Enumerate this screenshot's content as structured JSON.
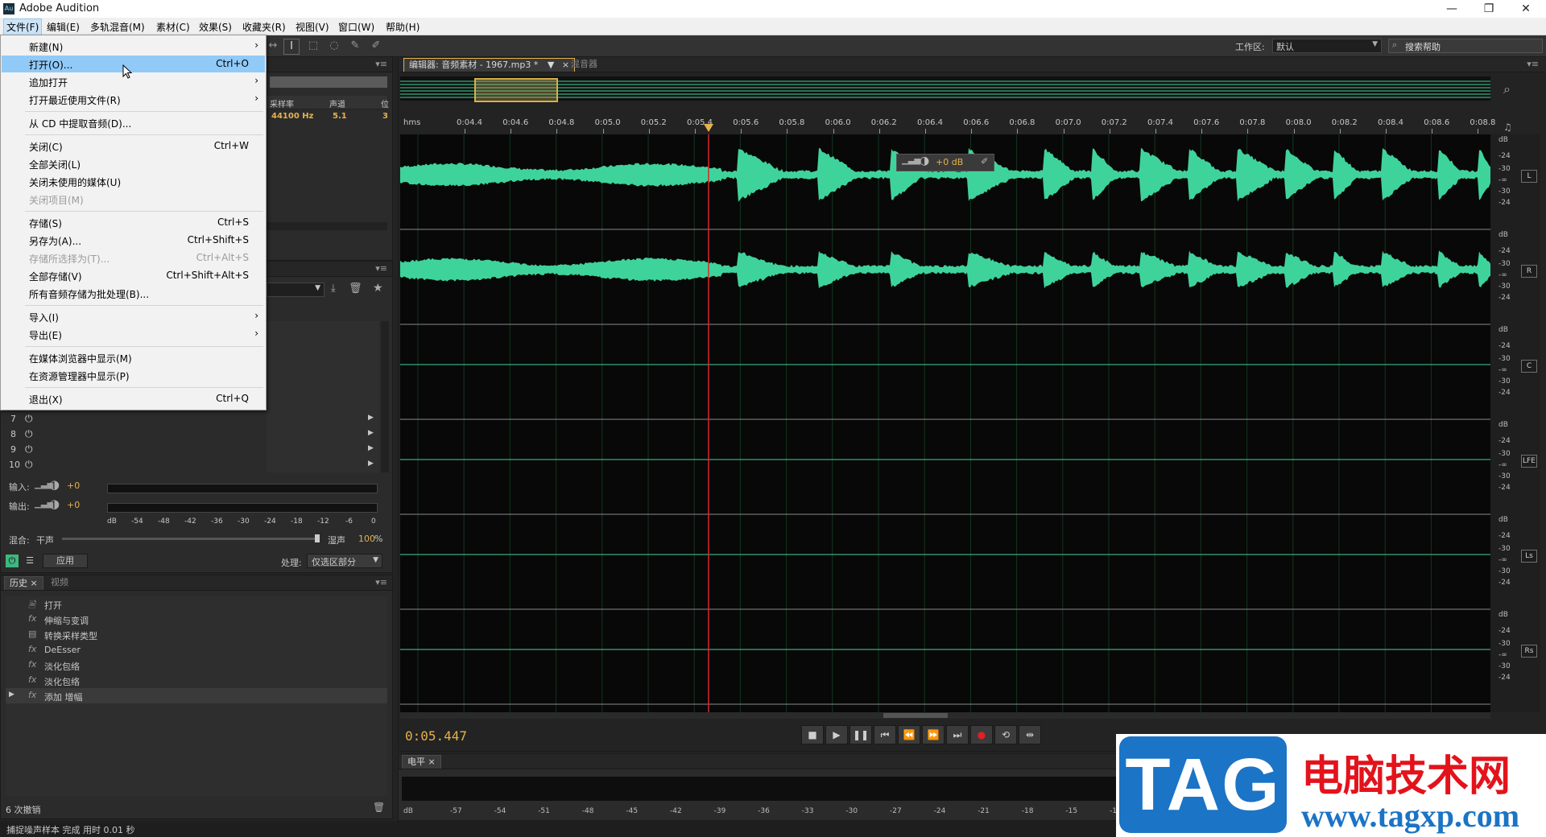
{
  "window": {
    "title": "Adobe Audition",
    "app_icon": "Au"
  },
  "menubar": [
    "文件(F)",
    "编辑(E)",
    "多轨混音(M)",
    "素材(C)",
    "效果(S)",
    "收藏夹(R)",
    "视图(V)",
    "窗口(W)",
    "帮助(H)"
  ],
  "workspace": {
    "label": "工作区:",
    "value": "默认"
  },
  "search": {
    "placeholder": "搜索帮助"
  },
  "file_menu": {
    "items": [
      {
        "label": "新建(N)",
        "shortcut": "",
        "submenu": true,
        "disabled": false
      },
      {
        "label": "打开(O)...",
        "shortcut": "Ctrl+O",
        "submenu": false,
        "disabled": false,
        "highlighted": true
      },
      {
        "label": "追加打开",
        "shortcut": "",
        "submenu": true,
        "disabled": false
      },
      {
        "label": "打开最近使用文件(R)",
        "shortcut": "",
        "submenu": true,
        "disabled": false
      },
      {
        "label": "从 CD 中提取音频(D)...",
        "shortcut": "",
        "submenu": false,
        "disabled": false
      },
      {
        "label": "关闭(C)",
        "shortcut": "Ctrl+W",
        "submenu": false,
        "disabled": false
      },
      {
        "label": "全部关闭(L)",
        "shortcut": "",
        "submenu": false,
        "disabled": false
      },
      {
        "label": "关闭未使用的媒体(U)",
        "shortcut": "",
        "submenu": false,
        "disabled": false
      },
      {
        "label": "关闭项目(M)",
        "shortcut": "",
        "submenu": false,
        "disabled": true
      },
      {
        "label": "存储(S)",
        "shortcut": "Ctrl+S",
        "submenu": false,
        "disabled": false
      },
      {
        "label": "另存为(A)...",
        "shortcut": "Ctrl+Shift+S",
        "submenu": false,
        "disabled": false
      },
      {
        "label": "存储所选择为(T)...",
        "shortcut": "Ctrl+Alt+S",
        "submenu": false,
        "disabled": true
      },
      {
        "label": "全部存储(V)",
        "shortcut": "Ctrl+Shift+Alt+S",
        "submenu": false,
        "disabled": false
      },
      {
        "label": "所有音频存储为批处理(B)...",
        "shortcut": "",
        "submenu": false,
        "disabled": false
      },
      {
        "label": "导入(I)",
        "shortcut": "",
        "submenu": true,
        "disabled": false
      },
      {
        "label": "导出(E)",
        "shortcut": "",
        "submenu": true,
        "disabled": false
      },
      {
        "label": "在媒体浏览器中显示(M)",
        "shortcut": "",
        "submenu": false,
        "disabled": false
      },
      {
        "label": "在资源管理器中显示(P)",
        "shortcut": "",
        "submenu": false,
        "disabled": false
      },
      {
        "label": "退出(X)",
        "shortcut": "Ctrl+Q",
        "submenu": false,
        "disabled": false
      }
    ]
  },
  "files_panel": {
    "columns": [
      "采样率",
      "声道",
      "位"
    ],
    "row": {
      "sample_rate": "44100 Hz",
      "channels": "5.1",
      "bits": "3"
    }
  },
  "effects_rack": {
    "tracks": [
      "7",
      "8",
      "9",
      "10"
    ],
    "input_label": "输入:",
    "output_label": "输出:",
    "input_value": "+0",
    "output_value": "+0",
    "meter_scale": [
      "dB",
      "-54",
      "-48",
      "-42",
      "-36",
      "-30",
      "-24",
      "-18",
      "-12",
      "-6",
      "0"
    ],
    "mix_label": "混合:",
    "dry_label": "干声",
    "wet_label": "湿声",
    "wet_value": "100",
    "wet_unit": "%",
    "apply_label": "应用",
    "process_label": "处理:",
    "process_value": "仅选区部分"
  },
  "history_panel": {
    "tabs": [
      "历史",
      "视频"
    ],
    "items": [
      {
        "icon": "doc",
        "label": "打开"
      },
      {
        "icon": "fx",
        "label": "伸缩与变调"
      },
      {
        "icon": "list",
        "label": "转换采样类型"
      },
      {
        "icon": "fx",
        "label": "DeEsser"
      },
      {
        "icon": "fx",
        "label": "淡化包络"
      },
      {
        "icon": "fx",
        "label": "淡化包络"
      },
      {
        "icon": "fx",
        "label": "添加 增幅"
      }
    ],
    "footer": "6 次撤销"
  },
  "editor": {
    "tab_title": "编辑器: 音频素材 - 1967.mp3 *",
    "mixer_tab": "混音器",
    "time_unit": "hms",
    "ruler": [
      "0:04.4",
      "0:04.6",
      "0:04.8",
      "0:05.0",
      "0:05.2",
      "0:05.4",
      "0:05.6",
      "0:05.8",
      "0:06.0",
      "0:06.2",
      "0:06.4",
      "0:06.6",
      "0:06.8",
      "0:07.0",
      "0:07.2",
      "0:07.4",
      "0:07.6",
      "0:07.8",
      "0:08.0",
      "0:08.2",
      "0:08.4",
      "0:08.6",
      "0:08.8"
    ],
    "hud_gain": "+0 dB",
    "channels": [
      "L",
      "R",
      "C",
      "LFE",
      "Ls",
      "Rs"
    ],
    "db_scale": [
      "dB",
      "-24",
      "-30",
      "-∞",
      "-30",
      "-24"
    ],
    "current_time": "0:05.447",
    "wave_color": "#3fd39c",
    "playhead_color": "#d8282d"
  },
  "levels_panel": {
    "tab": "电平",
    "scale": [
      "dB",
      "-57",
      "-54",
      "-51",
      "-48",
      "-45",
      "-42",
      "-39",
      "-36",
      "-33",
      "-30",
      "-27",
      "-24",
      "-21",
      "-18",
      "-15",
      "-12"
    ]
  },
  "status_bar": {
    "text": "捕捉噪声样本 完成 用时 0.01 秒"
  },
  "watermark": {
    "tag": "TAG",
    "cn": "电脑技术网",
    "url": "www.tagxp.com"
  }
}
